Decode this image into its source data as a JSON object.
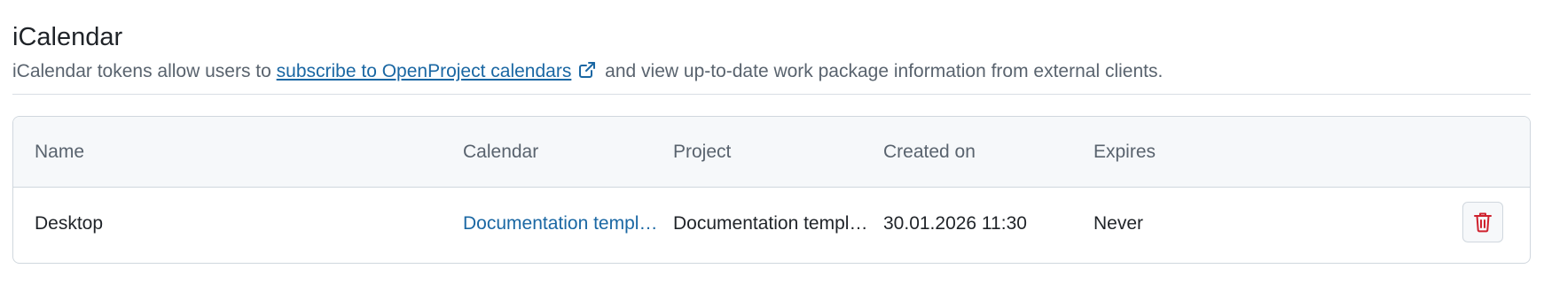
{
  "section": {
    "title": "iCalendar",
    "description_before": "iCalendar tokens allow users to ",
    "description_link": "subscribe to OpenProject calendars",
    "description_after": " and view up-to-date work package information from external clients."
  },
  "table": {
    "headers": {
      "name": "Name",
      "calendar": "Calendar",
      "project": "Project",
      "created_on": "Created on",
      "expires": "Expires"
    },
    "rows": [
      {
        "name": "Desktop",
        "calendar": "Documentation template",
        "project": "Documentation template",
        "created_on": "30.01.2026 11:30",
        "expires": "Never"
      }
    ]
  },
  "icons": {
    "external_link": "external-link-icon",
    "delete": "trash-icon"
  },
  "colors": {
    "link": "#1a67a3",
    "delete": "#cf222e",
    "header_bg": "#f6f8fa",
    "border": "#d0d7de"
  }
}
